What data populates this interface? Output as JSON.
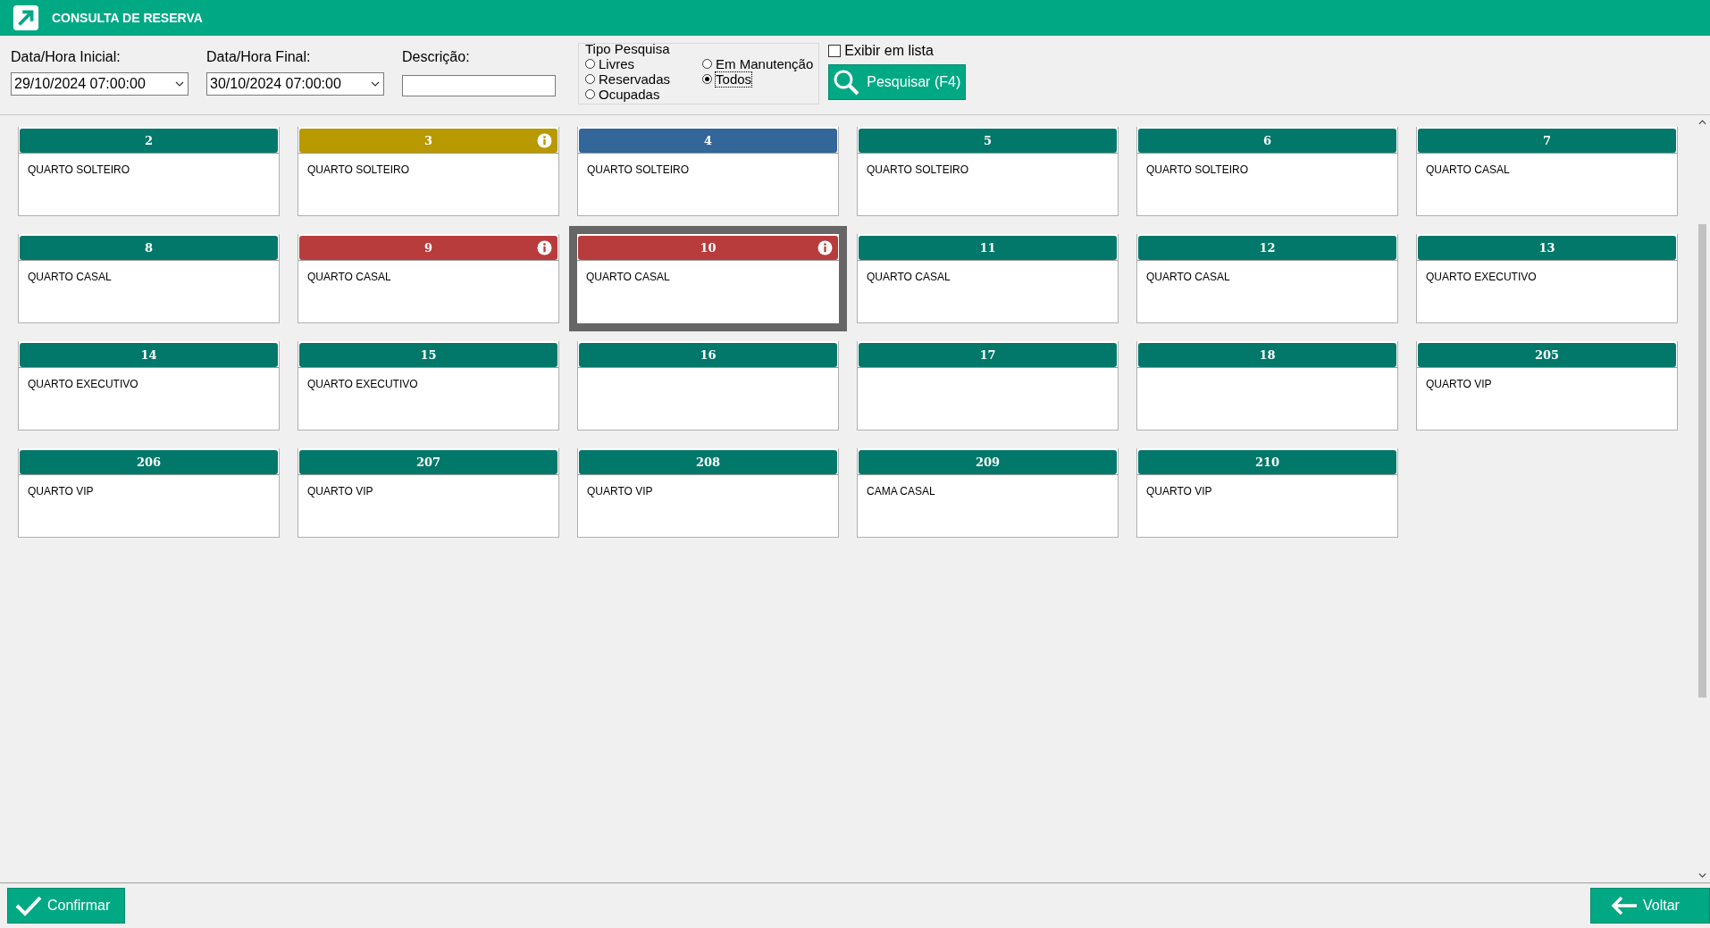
{
  "window": {
    "title": "CONSULTA DE RESERVA"
  },
  "filters": {
    "start": {
      "label": "Data/Hora Inicial:",
      "value": "29/10/2024 07:00:00"
    },
    "end": {
      "label": "Data/Hora Final:",
      "value": "30/10/2024 07:00:00"
    },
    "description": {
      "label": "Descrição:"
    },
    "search_type": {
      "label": "Tipo Pesquisa",
      "options": [
        {
          "label": "Livres",
          "selected": false
        },
        {
          "label": "Reservadas",
          "selected": false
        },
        {
          "label": "Ocupadas",
          "selected": false
        },
        {
          "label": "Em Manutenção",
          "selected": false
        },
        {
          "label": "Todos",
          "selected": true
        }
      ]
    },
    "list_view": {
      "label": "Exibir em lista",
      "checked": false
    },
    "search_button": "Pesquisar (F4)"
  },
  "rooms": [
    {
      "number": "2",
      "description": "QUARTO SOLTEIRO",
      "color": "#01786a",
      "info": false,
      "selected": false
    },
    {
      "number": "3",
      "description": "QUARTO SOLTEIRO",
      "color": "#b89900",
      "info": true,
      "selected": false
    },
    {
      "number": "4",
      "description": "QUARTO SOLTEIRO",
      "color": "#336699",
      "info": false,
      "selected": false
    },
    {
      "number": "5",
      "description": "QUARTO SOLTEIRO",
      "color": "#01786a",
      "info": false,
      "selected": false
    },
    {
      "number": "6",
      "description": "QUARTO SOLTEIRO",
      "color": "#01786a",
      "info": false,
      "selected": false
    },
    {
      "number": "7",
      "description": "QUARTO CASAL",
      "color": "#01786a",
      "info": false,
      "selected": false
    },
    {
      "number": "8",
      "description": "QUARTO CASAL",
      "color": "#01786a",
      "info": false,
      "selected": false
    },
    {
      "number": "9",
      "description": "QUARTO CASAL",
      "color": "#b83c3c",
      "info": true,
      "selected": false
    },
    {
      "number": "10",
      "description": "QUARTO CASAL",
      "color": "#b83c3c",
      "info": true,
      "selected": true
    },
    {
      "number": "11",
      "description": "QUARTO CASAL",
      "color": "#01786a",
      "info": false,
      "selected": false
    },
    {
      "number": "12",
      "description": "QUARTO CASAL",
      "color": "#01786a",
      "info": false,
      "selected": false
    },
    {
      "number": "13",
      "description": "QUARTO EXECUTIVO",
      "color": "#01786a",
      "info": false,
      "selected": false
    },
    {
      "number": "14",
      "description": "QUARTO EXECUTIVO",
      "color": "#01786a",
      "info": false,
      "selected": false
    },
    {
      "number": "15",
      "description": "QUARTO EXECUTIVO",
      "color": "#01786a",
      "info": false,
      "selected": false
    },
    {
      "number": "16",
      "color": "#01786a",
      "info": false,
      "selected": false
    },
    {
      "number": "17",
      "color": "#01786a",
      "info": false,
      "selected": false
    },
    {
      "number": "18",
      "color": "#01786a",
      "info": false,
      "selected": false
    },
    {
      "number": "205",
      "description": "QUARTO VIP",
      "color": "#01786a",
      "info": false,
      "selected": false
    },
    {
      "number": "206",
      "description": "QUARTO VIP",
      "color": "#01786a",
      "info": false,
      "selected": false
    },
    {
      "number": "207",
      "description": "QUARTO VIP",
      "color": "#01786a",
      "info": false,
      "selected": false
    },
    {
      "number": "208",
      "description": "QUARTO VIP",
      "color": "#01786a",
      "info": false,
      "selected": false
    },
    {
      "number": "209",
      "description": "CAMA CASAL",
      "color": "#01786a",
      "info": false,
      "selected": false
    },
    {
      "number": "210",
      "description": "QUARTO VIP",
      "color": "#01786a",
      "info": false,
      "selected": false
    }
  ],
  "footer": {
    "confirm": "Confirmar",
    "back": "Voltar"
  }
}
